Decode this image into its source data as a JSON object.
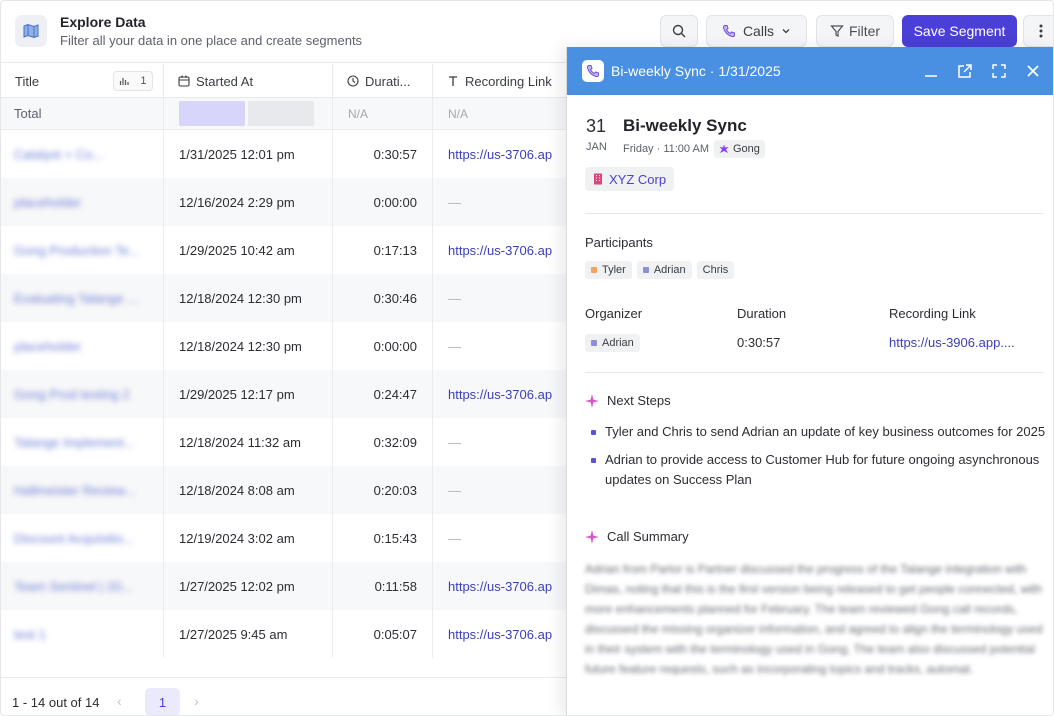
{
  "header": {
    "title": "Explore Data",
    "subtitle": "Filter all your data in one place and create segments",
    "calls_label": "Calls",
    "filter_label": "Filter",
    "save_label": "Save Segment"
  },
  "table": {
    "columns": [
      "Title",
      "Started At",
      "Durati...",
      "Recording Link"
    ],
    "title_badge_count": "1",
    "total_label": "Total",
    "total_na_duration": "N/A",
    "total_na_recording": "N/A",
    "rows": [
      {
        "title": "Catalyst + Co...",
        "started": "1/31/2025 12:01 pm",
        "duration": "0:30:57",
        "recording": "https://us-3706.ap"
      },
      {
        "title": "placeholder",
        "started": "12/16/2024 2:29 pm",
        "duration": "0:00:00",
        "recording": "—"
      },
      {
        "title": "Gong Production Te...",
        "started": "1/29/2025 10:42 am",
        "duration": "0:17:13",
        "recording": "https://us-3706.ap"
      },
      {
        "title": "Evaluating Talange ...",
        "started": "12/18/2024 12:30 pm",
        "duration": "0:30:46",
        "recording": "—"
      },
      {
        "title": "placeholder",
        "started": "12/18/2024 12:30 pm",
        "duration": "0:00:00",
        "recording": "—"
      },
      {
        "title": "Gong Prod testing 2",
        "started": "1/29/2025 12:17 pm",
        "duration": "0:24:47",
        "recording": "https://us-3706.ap"
      },
      {
        "title": "Talange Implement...",
        "started": "12/18/2024 11:32 am",
        "duration": "0:32:09",
        "recording": "—"
      },
      {
        "title": "Hallmeister Review...",
        "started": "12/18/2024 8:08 am",
        "duration": "0:20:03",
        "recording": "—"
      },
      {
        "title": "Discount Acquisitio...",
        "started": "12/19/2024 3:02 am",
        "duration": "0:15:43",
        "recording": "—"
      },
      {
        "title": "Team Sentinel | 20...",
        "started": "1/27/2025 12:02 pm",
        "duration": "0:11:58",
        "recording": "https://us-3706.ap"
      },
      {
        "title": "test 1",
        "started": "1/27/2025 9:45 am",
        "duration": "0:05:07",
        "recording": "https://us-3706.ap"
      }
    ]
  },
  "footer": {
    "range_text": "1 - 14 out of 14",
    "current_page": "1"
  },
  "panel": {
    "header_title": "Bi-weekly Sync · 1/31/2025",
    "day": "31",
    "month": "JAN",
    "title": "Bi-weekly Sync",
    "meta": "Friday · 11:00 AM",
    "source": "Gong",
    "company": "XYZ Corp",
    "participants_label": "Participants",
    "participants": [
      {
        "name": "Tyler",
        "color": "#f2a35e"
      },
      {
        "name": "Adrian",
        "color": "#8f8cd9"
      },
      {
        "name": "Chris",
        "color": ""
      }
    ],
    "organizer_label": "Organizer",
    "organizer": "Adrian",
    "duration_label": "Duration",
    "duration": "0:30:57",
    "recording_label": "Recording Link",
    "recording": "https://us-3906.app....",
    "next_steps_label": "Next Steps",
    "next_steps": [
      "Tyler and Chris to send Adrian an update of key business outcomes for 2025",
      "Adrian to provide access to Customer Hub for future ongoing asynchronous updates on Success Plan"
    ],
    "summary_label": "Call Summary",
    "summary": "Adrian from Parlor is Partner discussed the progress of the Talange integration with Dimas, noting that this is the first version being released to get people connected, with more enhancements planned for February. The team reviewed Gong call records, discussed the missing organizer information, and agreed to align the terminology used in their system with the terminology used in Gong. The team also discussed potential future feature requests, such as incorporating topics and tracks, automat."
  },
  "colors": {
    "accent": "#4a3fd6",
    "panel_header": "#4a90e2",
    "link": "#3b3fb8"
  }
}
